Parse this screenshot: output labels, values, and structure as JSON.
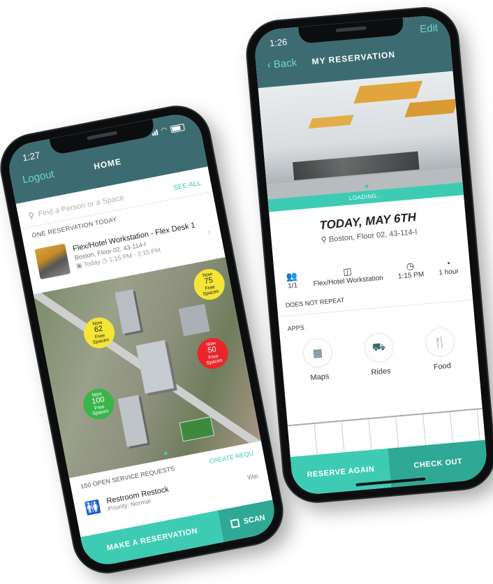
{
  "colors": {
    "header": "#3d6b72",
    "accent": "#3ecbb3",
    "accent_dark": "#2fa996",
    "yellow": "#f5e636",
    "green": "#39b54a",
    "red": "#e8262a"
  },
  "home": {
    "time": "1:27",
    "title": "HOME",
    "logout": "Logout",
    "search_placeholder": "Find a Person or a Space",
    "see_all": "SEE ALL",
    "section_title": "ONE RESERVATION TODAY",
    "reservation": {
      "title": "Flex/Hotel Workstation - Flex Desk 1",
      "location": "Boston, Floor 02, 43-114-I",
      "date": "Today",
      "time": "1:15 PM - 2:15 PM"
    },
    "markers": [
      {
        "label": "Now",
        "count": "62",
        "sub": "Free Spaces",
        "color": "yellow"
      },
      {
        "label": "Now",
        "count": "75",
        "sub": "Free Spaces",
        "color": "yellow"
      },
      {
        "label": "Now",
        "count": "100",
        "sub": "Free Spaces",
        "color": "green"
      },
      {
        "label": "Now",
        "count": "50",
        "sub": "Free Spaces",
        "color": "red"
      }
    ],
    "requests_title": "150 OPEN SERVICE REQUESTS",
    "create_request": "CREATE REQU",
    "request": {
      "title": "Restroom Restock",
      "priority": "Priority: Normal",
      "status": "Wai"
    },
    "make_reservation": "MAKE A RESERVATION",
    "scan": "SCAN"
  },
  "reservation": {
    "time": "1:26",
    "title": "MY RESERVATION",
    "back": "Back",
    "edit": "Edit",
    "loading": "LOADING...",
    "date": "TODAY, MAY 6TH",
    "location": "Boston, Floor 02, 43-114-I",
    "details": [
      {
        "icon": "people-icon",
        "value": "1/1"
      },
      {
        "icon": "desk-icon",
        "value": "Flex/Hotel Workstation"
      },
      {
        "icon": "clock-icon",
        "value": "1:15 PM"
      },
      {
        "icon": "stopwatch-icon",
        "value": "1 hour"
      }
    ],
    "repeat": "DOES NOT REPEAT",
    "apps_title": "APPS",
    "apps": [
      {
        "icon": "map-icon",
        "label": "Maps"
      },
      {
        "icon": "car-icon",
        "label": "Rides"
      },
      {
        "icon": "fork-knife-icon",
        "label": "Food"
      }
    ],
    "reserve_again": "RESERVE AGAIN",
    "check_out": "CHECK OUT"
  }
}
